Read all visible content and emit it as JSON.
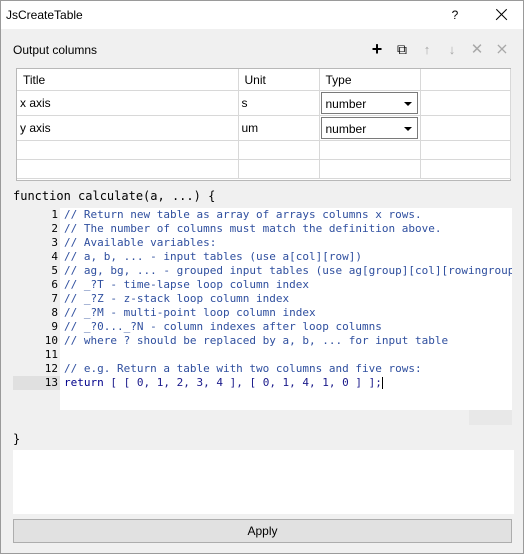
{
  "window": {
    "title": "JsCreateTable",
    "help_label": "?",
    "close_icon": "close-icon"
  },
  "output_columns": {
    "label": "Output columns",
    "toolbar": [
      {
        "icon": "plus-icon",
        "glyph": "+",
        "enabled": true
      },
      {
        "icon": "copy-icon",
        "glyph": "⧉",
        "enabled": true
      },
      {
        "icon": "move-up-icon",
        "glyph": "↑",
        "enabled": false
      },
      {
        "icon": "move-down-icon",
        "glyph": "↓",
        "enabled": false
      },
      {
        "icon": "delete-icon",
        "glyph": "✕",
        "enabled": false
      },
      {
        "icon": "delete-all-icon",
        "glyph": "⨯",
        "enabled": false
      }
    ],
    "headers": [
      "Title",
      "Unit",
      "Type",
      ""
    ],
    "rows": [
      {
        "title": "x axis",
        "unit": "s",
        "type": "number"
      },
      {
        "title": "y axis",
        "unit": "um",
        "type": "number"
      }
    ]
  },
  "editor": {
    "header": "function calculate(a, ...) {",
    "footer": "}",
    "current_line": 13,
    "lines": [
      "// Return new table as array of arrays columns x rows.",
      "// The number of columns must match the definition above.",
      "// Available variables:",
      "// a, b, ... - input tables (use a[col][row])",
      "// ag, bg, ... - grouped input tables (use ag[group][col][rowingroup",
      "// _?T - time-lapse loop column index",
      "// _?Z - z-stack loop column index",
      "// _?M - multi-point loop column index",
      "// _?0..._?N - column indexes after loop columns",
      "// where ? should be replaced by a, b, ... for input table",
      "",
      "// e.g. Return a table with two columns and five rows:",
      "return [ [ 0, 1, 2, 3, 4 ], [ 0, 1, 4, 1, 0 ] ];"
    ],
    "output_text": ""
  },
  "apply_label": "Apply"
}
